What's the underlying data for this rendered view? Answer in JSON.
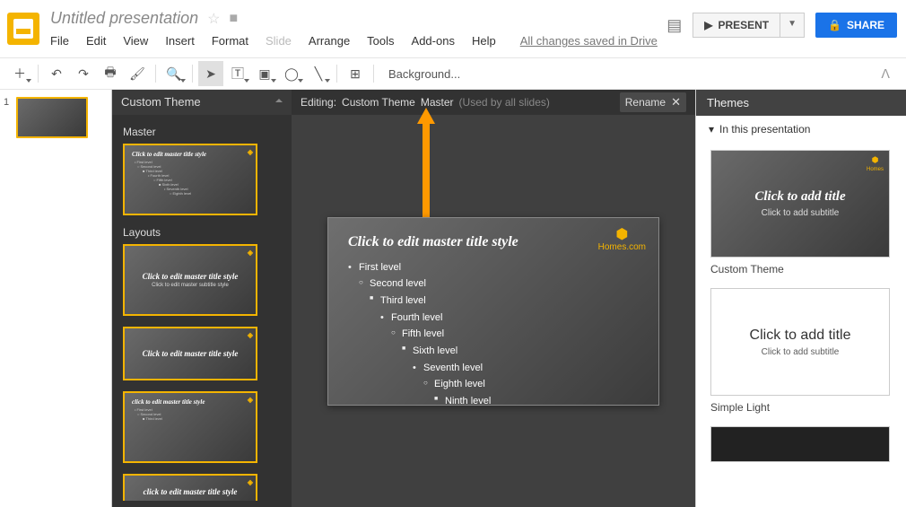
{
  "doc_title": "Untitled presentation",
  "menu": {
    "file": "File",
    "edit": "Edit",
    "view": "View",
    "insert": "Insert",
    "format": "Format",
    "slide": "Slide",
    "arrange": "Arrange",
    "tools": "Tools",
    "addons": "Add-ons",
    "help": "Help"
  },
  "save_status": "All changes saved in Drive",
  "header_buttons": {
    "present": "PRESENT",
    "share": "SHARE"
  },
  "toolbar": {
    "background": "Background..."
  },
  "layout_panel": {
    "title": "Custom Theme",
    "master_label": "Master",
    "layouts_label": "Layouts"
  },
  "layout_thumbs": {
    "master_title": "Click to edit master title style",
    "title_layout_title": "Click to edit master title style",
    "title_layout_sub": "Click to edit master subtitle style",
    "section_title": "Click to edit master title style",
    "content_title": "click to edit master title style"
  },
  "canvas_header": {
    "editing": "Editing:",
    "theme_name": "Custom Theme",
    "master": "Master",
    "used_by": "(Used by all slides)",
    "rename": "Rename"
  },
  "master_slide": {
    "title": "Click to edit master title style",
    "levels": [
      "First level",
      "Second level",
      "Third level",
      "Fourth level",
      "Fifth level",
      "Sixth level",
      "Seventh level",
      "Eighth level",
      "Ninth level"
    ],
    "logo_text": "Homes.com"
  },
  "themes": {
    "header": "Themes",
    "sub": "In this presentation",
    "items": [
      {
        "title": "Click to add title",
        "sub": "Click to add subtitle",
        "name": "Custom Theme",
        "variant": "dark"
      },
      {
        "title": "Click to add title",
        "sub": "Click to add subtitle",
        "name": "Simple Light",
        "variant": "light"
      }
    ]
  },
  "slide_nav_number": "1"
}
